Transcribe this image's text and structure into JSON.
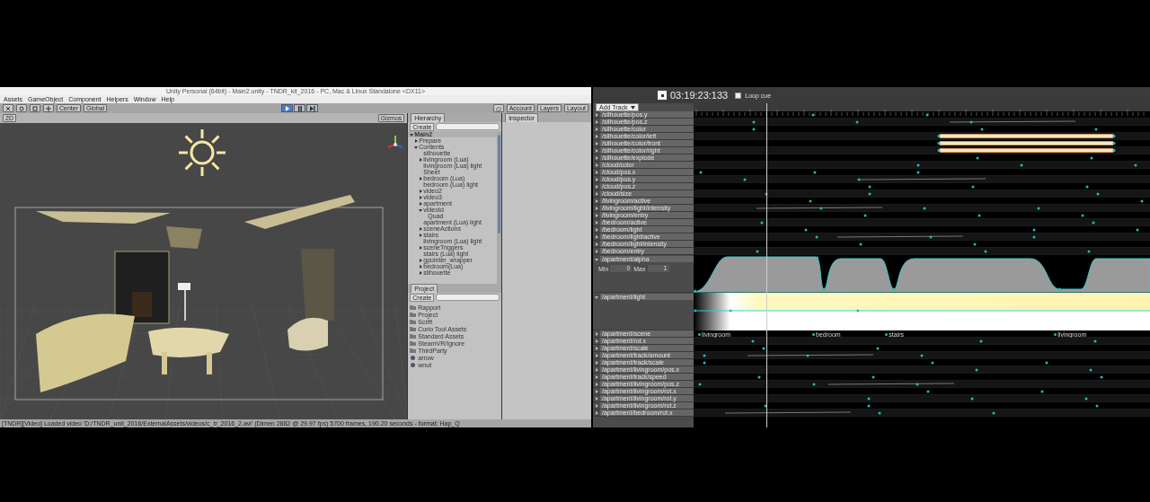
{
  "unity": {
    "title": "Unity Personal (64bit) - Main2.unity - TNDR_kit_2016 - PC, Mac & Linux Standalone <DX11>",
    "menu": [
      "Assets",
      "GameObject",
      "Component",
      "Helpers",
      "Window",
      "Help"
    ],
    "toolbar": {
      "pivot": "Center",
      "space": "Global",
      "play_buttons": [
        {
          "kind": "play",
          "on": true
        },
        {
          "kind": "pause",
          "on": false
        },
        {
          "kind": "step",
          "on": false
        }
      ],
      "account": "Account",
      "layers": "Layers",
      "layout": "Layout"
    },
    "scene_bar": {
      "mode": "2D",
      "gizmos": "Gizmos"
    },
    "hierarchy": {
      "tab": "Hierarchy",
      "create": "Create",
      "items": [
        {
          "name": "Main2",
          "expanded": true,
          "children": [
            {
              "name": "Prepare",
              "expanded": false
            },
            {
              "name": "Contents",
              "expanded": true,
              "children": [
                {
                  "name": "silhouette"
                },
                {
                  "name": "livingroom (Lua)",
                  "expanded": false
                },
                {
                  "name": "livingroom (Lua) light"
                },
                {
                  "name": "Sheet"
                },
                {
                  "name": "bedroom (Lua)",
                  "expanded": false
                },
                {
                  "name": "bedroom (Lua) light"
                },
                {
                  "name": "video2",
                  "expanded": false
                },
                {
                  "name": "video3",
                  "expanded": false
                },
                {
                  "name": "apartment",
                  "expanded": false
                },
                {
                  "name": "videoId",
                  "expanded": true,
                  "children": [
                    {
                      "name": "Quad"
                    }
                  ]
                },
                {
                  "name": "apartment (Lua) light"
                },
                {
                  "name": "sceneActions",
                  "expanded": false
                },
                {
                  "name": "stairs",
                  "expanded": false
                },
                {
                  "name": "livingroom (Lua) light"
                },
                {
                  "name": "sceneTriggers",
                  "expanded": false
                },
                {
                  "name": "stairs (Lua) light"
                },
                {
                  "name": "gpointer_wrapper",
                  "expanded": false
                },
                {
                  "name": "bedroom(Lua)",
                  "expanded": false
                },
                {
                  "name": "silhouette",
                  "expanded": false
                }
              ]
            }
          ]
        }
      ]
    },
    "inspector": {
      "tab": "Inspector"
    },
    "project": {
      "tab": "Project",
      "create": "Create",
      "items": [
        {
          "name": "Rapport",
          "kind": "folder"
        },
        {
          "name": "Project",
          "kind": "folder"
        },
        {
          "name": "Scrift",
          "kind": "folder"
        },
        {
          "name": "Curio Tool Assets",
          "kind": "folder"
        },
        {
          "name": "Standard Assets",
          "kind": "folder"
        },
        {
          "name": "SteamVR/Ignore",
          "kind": "folder"
        },
        {
          "name": "ThirdParty",
          "kind": "folder"
        },
        {
          "name": "arrow",
          "kind": "asset"
        },
        {
          "name": "wnut",
          "kind": "asset"
        }
      ]
    },
    "status": "[TNDR][Video] Loaded video 'D:/TNDR_unit_2016/ExternalAssets/videos/c_tr_2016_2.avi' (Dimen 2882 @ 29.97 fps) 5700 frames, 190.20 seconds - format: Hap_Q"
  },
  "timeline": {
    "time": "03:19:23:133",
    "loop": {
      "label": "Loop cue",
      "checked": false
    },
    "add_track": "Add Track",
    "tracks": [
      {
        "name": "/silhouette/pos.y",
        "kind": "keys",
        "expanded": false
      },
      {
        "name": "/silhouette/pos.z",
        "kind": "keys",
        "expanded": false
      },
      {
        "name": "/silhouette/color",
        "kind": "keys",
        "expanded": false
      },
      {
        "name": "/silhouette/color/left",
        "kind": "bar",
        "expanded": false
      },
      {
        "name": "/silhouette/color/front",
        "kind": "bar",
        "expanded": false
      },
      {
        "name": "/silhouette/color/right",
        "kind": "bar",
        "expanded": false
      },
      {
        "name": "/silhouette/explode",
        "kind": "keys",
        "expanded": false
      },
      {
        "name": "/cloud/color",
        "kind": "keys",
        "expanded": false
      },
      {
        "name": "/cloud/pos.x",
        "kind": "keys",
        "expanded": false
      },
      {
        "name": "/cloud/pos.y",
        "kind": "keys",
        "expanded": false
      },
      {
        "name": "/cloud/pos.z",
        "kind": "keys",
        "expanded": false
      },
      {
        "name": "/cloud/size",
        "kind": "keys",
        "expanded": false
      },
      {
        "name": "/livingroom/active",
        "kind": "keys",
        "expanded": false
      },
      {
        "name": "/livingroom/light/intensity",
        "kind": "keys",
        "expanded": false
      },
      {
        "name": "/livingroom/entry",
        "kind": "keys",
        "expanded": false
      },
      {
        "name": "/bedroom/active",
        "kind": "keys",
        "expanded": false
      },
      {
        "name": "/bedroom/light",
        "kind": "keys",
        "expanded": false
      },
      {
        "name": "/bedroom/light/active",
        "kind": "keys",
        "expanded": false
      },
      {
        "name": "/bedroom/light/intensity",
        "kind": "keys",
        "expanded": false
      },
      {
        "name": "/bedroom/entry",
        "kind": "keys",
        "expanded": false
      },
      {
        "name": "/apartment/alpha",
        "kind": "curve",
        "expanded": true,
        "min_label": "Min",
        "min": "0",
        "max_label": "Max",
        "max": "1"
      },
      {
        "name": "/apartment/light",
        "kind": "gradient",
        "expanded": true
      },
      {
        "name": "/apartment/scene",
        "kind": "scene",
        "expanded": false,
        "markers": [
          "livingroom",
          "bedroom",
          "stairs",
          "livingroom"
        ]
      },
      {
        "name": "/apartment/rot.x",
        "kind": "keys",
        "expanded": false
      },
      {
        "name": "/apartment/scale",
        "kind": "keys",
        "expanded": false
      },
      {
        "name": "/apartment/track/amount",
        "kind": "keys",
        "expanded": false
      },
      {
        "name": "/apartment/track/scale",
        "kind": "keys",
        "expanded": false
      },
      {
        "name": "/apartment/livingroom/pos.x",
        "kind": "keys",
        "expanded": false
      },
      {
        "name": "/apartment/track/speed",
        "kind": "keys",
        "expanded": false
      },
      {
        "name": "/apartment/livingroom/pos.z",
        "kind": "keys",
        "expanded": false
      },
      {
        "name": "/apartment/livingroom/rot.x",
        "kind": "keys",
        "expanded": false
      },
      {
        "name": "/apartment/livingroom/rot.y",
        "kind": "keys",
        "expanded": false
      },
      {
        "name": "/apartment/livingroom/rot.z",
        "kind": "keys",
        "expanded": false
      },
      {
        "name": "/apartment/bedroom/rot.x",
        "kind": "keys",
        "expanded": false
      }
    ]
  }
}
